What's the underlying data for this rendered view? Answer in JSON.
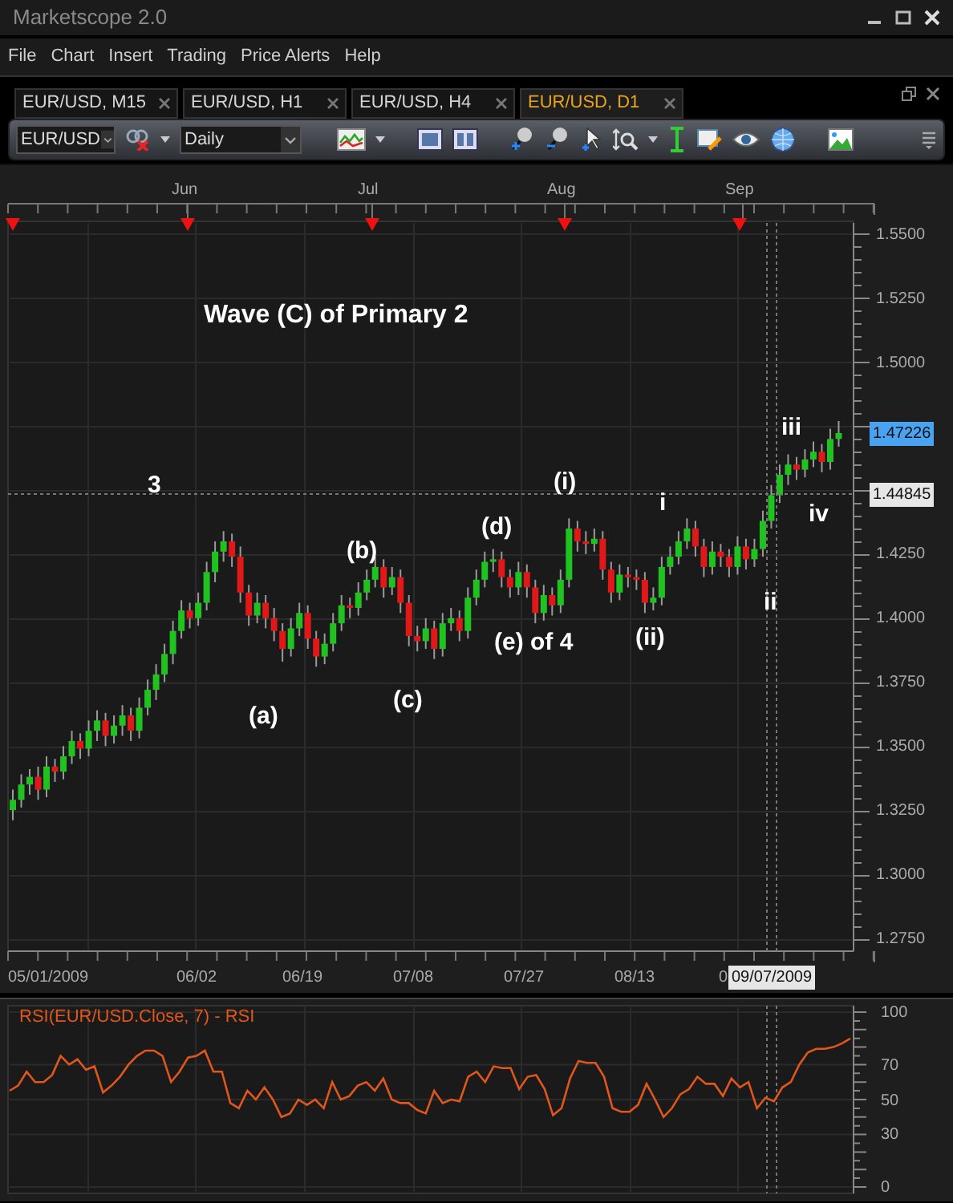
{
  "window": {
    "title": "Marketscope 2.0"
  },
  "menu": [
    "File",
    "Chart",
    "Insert",
    "Trading",
    "Price Alerts",
    "Help"
  ],
  "tabs": [
    {
      "label": "EUR/USD, M15",
      "selected": false
    },
    {
      "label": "EUR/USD, H1",
      "selected": false
    },
    {
      "label": "EUR/USD, H4",
      "selected": false
    },
    {
      "label": "EUR/USD, D1",
      "selected": true
    }
  ],
  "toolbar": {
    "symbol": "EUR/USD",
    "timeframe": "Daily"
  },
  "price_chart": {
    "month_labels": [
      "Jun",
      "Jul",
      "Aug",
      "Sep"
    ],
    "current_price": "1.47226",
    "crosshair_price": "1.44845",
    "date_labels": [
      "05/01/2009",
      "06/02",
      "06/19",
      "07/08",
      "07/27",
      "08/13",
      "0"
    ],
    "cursor_date": "09/07/2009",
    "annotations": [
      "Wave (C) of Primary 2",
      "3",
      "(b)",
      "(d)",
      "(i)",
      "i",
      "iii",
      "iv",
      "ii",
      "(ii)",
      "(e) of 4",
      "(a)",
      "(c)"
    ],
    "chart_data": {
      "type": "candlestick",
      "ylim": [
        1.2705,
        1.5544
      ],
      "grid": true,
      "yticks": [
        {
          "value": 1.55,
          "label": "1.5500"
        },
        {
          "value": 1.525,
          "label": "1.5250"
        },
        {
          "value": 1.5,
          "label": "1.5000"
        },
        {
          "value": 1.425,
          "label": "1.4250"
        },
        {
          "value": 1.4,
          "label": "1.4000"
        },
        {
          "value": 1.375,
          "label": "1.3750"
        },
        {
          "value": 1.35,
          "label": "1.3500"
        },
        {
          "value": 1.325,
          "label": "1.3250"
        },
        {
          "value": 1.3,
          "label": "1.3000"
        },
        {
          "value": 1.275,
          "label": "1.2750"
        }
      ],
      "ohlc": [
        [
          1.325,
          1.333,
          1.321,
          1.329
        ],
        [
          1.329,
          1.339,
          1.326,
          1.335
        ],
        [
          1.335,
          1.341,
          1.331,
          1.338
        ],
        [
          1.338,
          1.342,
          1.329,
          1.333
        ],
        [
          1.333,
          1.346,
          1.33,
          1.342
        ],
        [
          1.342,
          1.345,
          1.336,
          1.34
        ],
        [
          1.34,
          1.35,
          1.337,
          1.346
        ],
        [
          1.346,
          1.356,
          1.343,
          1.352
        ],
        [
          1.352,
          1.355,
          1.345,
          1.349
        ],
        [
          1.349,
          1.36,
          1.346,
          1.356
        ],
        [
          1.356,
          1.364,
          1.352,
          1.36
        ],
        [
          1.36,
          1.363,
          1.35,
          1.354
        ],
        [
          1.354,
          1.362,
          1.351,
          1.358
        ],
        [
          1.358,
          1.366,
          1.354,
          1.362
        ],
        [
          1.362,
          1.365,
          1.352,
          1.356
        ],
        [
          1.356,
          1.369,
          1.353,
          1.365
        ],
        [
          1.365,
          1.376,
          1.362,
          1.372
        ],
        [
          1.372,
          1.382,
          1.368,
          1.378
        ],
        [
          1.378,
          1.39,
          1.375,
          1.386
        ],
        [
          1.386,
          1.399,
          1.382,
          1.395
        ],
        [
          1.395,
          1.407,
          1.392,
          1.403
        ],
        [
          1.403,
          1.406,
          1.396,
          1.4
        ],
        [
          1.4,
          1.41,
          1.397,
          1.406
        ],
        [
          1.406,
          1.422,
          1.403,
          1.418
        ],
        [
          1.418,
          1.43,
          1.414,
          1.426
        ],
        [
          1.426,
          1.434,
          1.422,
          1.43
        ],
        [
          1.43,
          1.433,
          1.42,
          1.424
        ],
        [
          1.424,
          1.428,
          1.406,
          1.41
        ],
        [
          1.41,
          1.413,
          1.397,
          1.401
        ],
        [
          1.401,
          1.41,
          1.398,
          1.406
        ],
        [
          1.406,
          1.409,
          1.396,
          1.4
        ],
        [
          1.4,
          1.404,
          1.391,
          1.395
        ],
        [
          1.395,
          1.398,
          1.383,
          1.388
        ],
        [
          1.388,
          1.4,
          1.385,
          1.396
        ],
        [
          1.396,
          1.406,
          1.393,
          1.402
        ],
        [
          1.402,
          1.405,
          1.388,
          1.392
        ],
        [
          1.392,
          1.395,
          1.381,
          1.385
        ],
        [
          1.385,
          1.394,
          1.382,
          1.39
        ],
        [
          1.39,
          1.402,
          1.387,
          1.398
        ],
        [
          1.398,
          1.409,
          1.395,
          1.405
        ],
        [
          1.405,
          1.408,
          1.4,
          1.404
        ],
        [
          1.404,
          1.414,
          1.401,
          1.41
        ],
        [
          1.41,
          1.419,
          1.407,
          1.415
        ],
        [
          1.415,
          1.424,
          1.412,
          1.42
        ],
        [
          1.42,
          1.423,
          1.408,
          1.412
        ],
        [
          1.412,
          1.42,
          1.409,
          1.416
        ],
        [
          1.416,
          1.419,
          1.402,
          1.406
        ],
        [
          1.406,
          1.409,
          1.389,
          1.393
        ],
        [
          1.393,
          1.397,
          1.387,
          1.391
        ],
        [
          1.391,
          1.4,
          1.388,
          1.396
        ],
        [
          1.396,
          1.399,
          1.384,
          1.388
        ],
        [
          1.388,
          1.402,
          1.385,
          1.398
        ],
        [
          1.398,
          1.404,
          1.395,
          1.4
        ],
        [
          1.4,
          1.403,
          1.391,
          1.395
        ],
        [
          1.395,
          1.412,
          1.392,
          1.408
        ],
        [
          1.408,
          1.419,
          1.405,
          1.415
        ],
        [
          1.415,
          1.426,
          1.412,
          1.422
        ],
        [
          1.422,
          1.427,
          1.418,
          1.423
        ],
        [
          1.423,
          1.426,
          1.412,
          1.416
        ],
        [
          1.416,
          1.419,
          1.408,
          1.412
        ],
        [
          1.412,
          1.422,
          1.409,
          1.418
        ],
        [
          1.418,
          1.421,
          1.408,
          1.412
        ],
        [
          1.412,
          1.415,
          1.398,
          1.402
        ],
        [
          1.402,
          1.413,
          1.399,
          1.409
        ],
        [
          1.409,
          1.412,
          1.401,
          1.405
        ],
        [
          1.405,
          1.419,
          1.402,
          1.415
        ],
        [
          1.415,
          1.439,
          1.412,
          1.435
        ],
        [
          1.435,
          1.438,
          1.426,
          1.43
        ],
        [
          1.43,
          1.434,
          1.425,
          1.429
        ],
        [
          1.429,
          1.435,
          1.426,
          1.431
        ],
        [
          1.431,
          1.434,
          1.415,
          1.419
        ],
        [
          1.419,
          1.422,
          1.406,
          1.41
        ],
        [
          1.41,
          1.421,
          1.407,
          1.417
        ],
        [
          1.417,
          1.42,
          1.412,
          1.416
        ],
        [
          1.416,
          1.419,
          1.411,
          1.415
        ],
        [
          1.415,
          1.418,
          1.402,
          1.406
        ],
        [
          1.406,
          1.412,
          1.403,
          1.408
        ],
        [
          1.408,
          1.424,
          1.405,
          1.42
        ],
        [
          1.42,
          1.428,
          1.417,
          1.424
        ],
        [
          1.424,
          1.434,
          1.421,
          1.43
        ],
        [
          1.43,
          1.439,
          1.427,
          1.435
        ],
        [
          1.435,
          1.438,
          1.424,
          1.428
        ],
        [
          1.428,
          1.431,
          1.416,
          1.42
        ],
        [
          1.42,
          1.43,
          1.417,
          1.426
        ],
        [
          1.426,
          1.429,
          1.42,
          1.424
        ],
        [
          1.424,
          1.427,
          1.416,
          1.42
        ],
        [
          1.42,
          1.432,
          1.417,
          1.428
        ],
        [
          1.428,
          1.431,
          1.419,
          1.423
        ],
        [
          1.423,
          1.431,
          1.42,
          1.427
        ],
        [
          1.427,
          1.442,
          1.424,
          1.438
        ],
        [
          1.438,
          1.452,
          1.435,
          1.448
        ],
        [
          1.448,
          1.46,
          1.445,
          1.456
        ],
        [
          1.456,
          1.464,
          1.452,
          1.46
        ],
        [
          1.46,
          1.463,
          1.454,
          1.458
        ],
        [
          1.458,
          1.466,
          1.455,
          1.462
        ],
        [
          1.462,
          1.469,
          1.459,
          1.465
        ],
        [
          1.465,
          1.468,
          1.457,
          1.461
        ],
        [
          1.461,
          1.474,
          1.458,
          1.47
        ],
        [
          1.47,
          1.477,
          1.467,
          1.4723
        ]
      ]
    }
  },
  "rsi_panel": {
    "chart_data": {
      "type": "line",
      "title": "RSI(EUR/USD.Close, 7) - RSI",
      "ylim": [
        0,
        100
      ],
      "yticks": [
        0,
        30,
        50,
        70,
        100
      ],
      "grid": true,
      "series": [
        {
          "color": "#e0561b",
          "values": [
            55,
            58,
            66,
            60,
            60,
            64,
            75,
            70,
            73,
            67,
            69,
            54,
            58,
            63,
            70,
            75,
            78,
            78,
            75,
            60,
            66,
            74,
            75,
            78,
            66,
            66,
            48,
            45,
            55,
            50,
            57,
            50,
            40,
            42,
            50,
            47,
            50,
            45,
            60,
            50,
            52,
            58,
            60,
            55,
            62,
            50,
            48,
            48,
            44,
            42,
            55,
            48,
            50,
            49,
            63,
            66,
            60,
            69,
            68,
            68,
            56,
            63,
            64,
            56,
            41,
            45,
            62,
            72,
            71,
            71,
            63,
            45,
            43,
            43,
            47,
            59,
            50,
            40,
            45,
            53,
            56,
            63,
            59,
            59,
            52,
            62,
            57,
            60,
            45,
            51,
            49,
            57,
            60,
            70,
            77,
            79,
            79,
            80,
            82,
            85
          ]
        }
      ]
    }
  }
}
